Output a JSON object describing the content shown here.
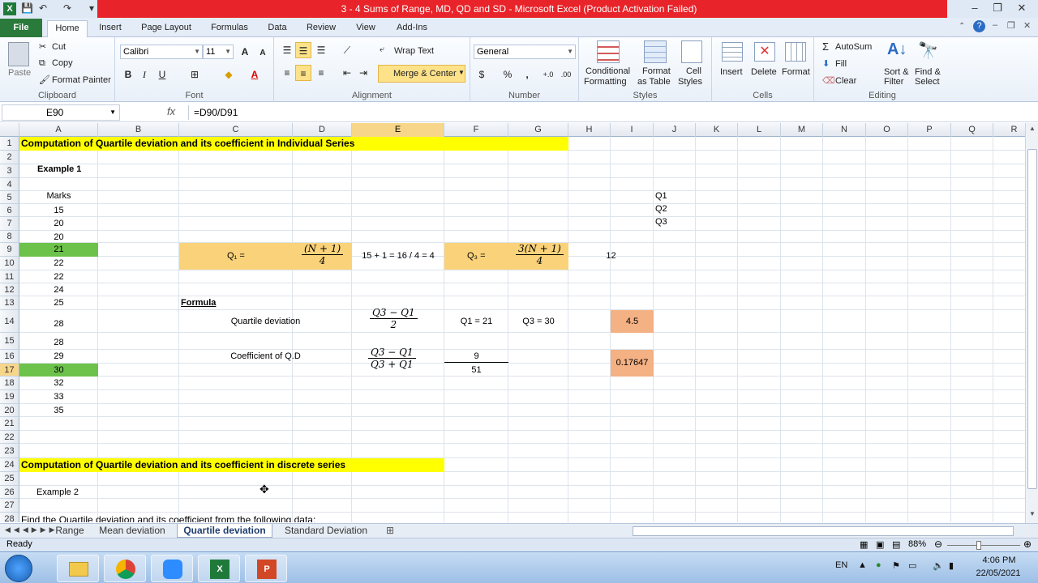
{
  "window": {
    "title": "3 - 4  Sums of Range, MD, QD and SD  -  Microsoft Excel (Product Activation Failed)",
    "minimize": "–",
    "restore": "❐",
    "close": "✕"
  },
  "ribbon_tabs": [
    "File",
    "Home",
    "Insert",
    "Page Layout",
    "Formulas",
    "Data",
    "Review",
    "View",
    "Add-Ins"
  ],
  "clipboard": {
    "paste": "Paste",
    "cut": "Cut",
    "copy": "Copy",
    "format_painter": "Format Painter",
    "label": "Clipboard"
  },
  "font": {
    "name": "Calibri",
    "size": "11",
    "bold": "B",
    "italic": "I",
    "underline": "U",
    "label": "Font"
  },
  "alignment": {
    "wrap_text": "Wrap Text",
    "merge_center": "Merge & Center",
    "label": "Alignment"
  },
  "number": {
    "format": "General",
    "currency": "$",
    "percent": "%",
    "comma": ",",
    "inc_dec": "+.0",
    "dec_dec": ".00",
    "label": "Number"
  },
  "styles": {
    "conditional_1": "Conditional",
    "conditional_2": "Formatting",
    "format_table_1": "Format",
    "format_table_2": "as Table",
    "cell_styles_1": "Cell",
    "cell_styles_2": "Styles",
    "label": "Styles"
  },
  "cells": {
    "insert": "Insert",
    "delete": "Delete",
    "format": "Format",
    "label": "Cells"
  },
  "editing": {
    "autosum": "AutoSum",
    "fill": "Fill",
    "clear": "Clear",
    "sort_1": "Sort &",
    "sort_2": "Filter",
    "find_1": "Find &",
    "find_2": "Select",
    "label": "Editing"
  },
  "formula_bar": {
    "name_box": "E90",
    "fx": "fx",
    "formula": "=D90/D91"
  },
  "columns": [
    "A",
    "B",
    "C",
    "D",
    "E",
    "F",
    "G",
    "H",
    "I",
    "J",
    "K",
    "L",
    "M",
    "N",
    "O",
    "P",
    "Q",
    "R"
  ],
  "rows": [
    "1",
    "2",
    "3",
    "4",
    "5",
    "6",
    "7",
    "8",
    "9",
    "10",
    "11",
    "12",
    "13",
    "14",
    "15",
    "16",
    "17",
    "18",
    "19",
    "20",
    "21",
    "22",
    "23",
    "24",
    "25",
    "26",
    "27",
    "28"
  ],
  "cells_content": {
    "title1": "Computation of Quartile deviation and its coefficient in Individual Series",
    "example1": "Example 1",
    "marks": "Marks",
    "marks_values": [
      "15",
      "20",
      "20",
      "21",
      "22",
      "22",
      "24",
      "25",
      "28",
      "28",
      "29",
      "30",
      "32",
      "33",
      "35"
    ],
    "q1_label": "Q₁ =",
    "q1_frac_num": "(N + 1)",
    "q1_frac_den": "4",
    "e10": "15 + 1 = 16 / 4 = 4",
    "q3_label": "Q₃ =",
    "q3_frac_num": "3(N + 1)",
    "q3_frac_den": "4",
    "i10": "12",
    "j5": "Q1",
    "j6": "Q2",
    "j7": "Q3",
    "formula_heading": "Formula",
    "quartile_deviation": "Quartile deviation",
    "qd_frac_num": "Q3 − Q1",
    "qd_frac_den": "2",
    "f14": "Q1 = 21",
    "g14": "Q3 = 30",
    "i14": "4.5",
    "coefficient": "Coefficient of Q.D",
    "coef_frac_num": "Q3 − Q1",
    "coef_frac_den": "Q3 + Q1",
    "f16": "9",
    "f17": "51",
    "i16": "0.17647",
    "title2": "Computation of Quartile deviation and its coefficient in discrete series",
    "example2": "Example 2",
    "a28": "Find the Quartile deviation and its coefficient from the following data:"
  },
  "sheet_tabs": [
    "Range",
    "Mean deviation",
    "Quartile deviation",
    "Standard Deviation"
  ],
  "status": {
    "ready": "Ready",
    "zoom": "88%"
  },
  "taskbar": {
    "lang": "EN",
    "time": "4:06 PM",
    "date": "22/05/2021"
  },
  "colors": {
    "excel_green": "#2a7a3b",
    "title_red": "#e8242a",
    "highlight_yellow": "#ffff00",
    "green_fill": "#6dc24b",
    "orange_fill": "#fad27a",
    "salmon_fill": "#f4b183"
  }
}
